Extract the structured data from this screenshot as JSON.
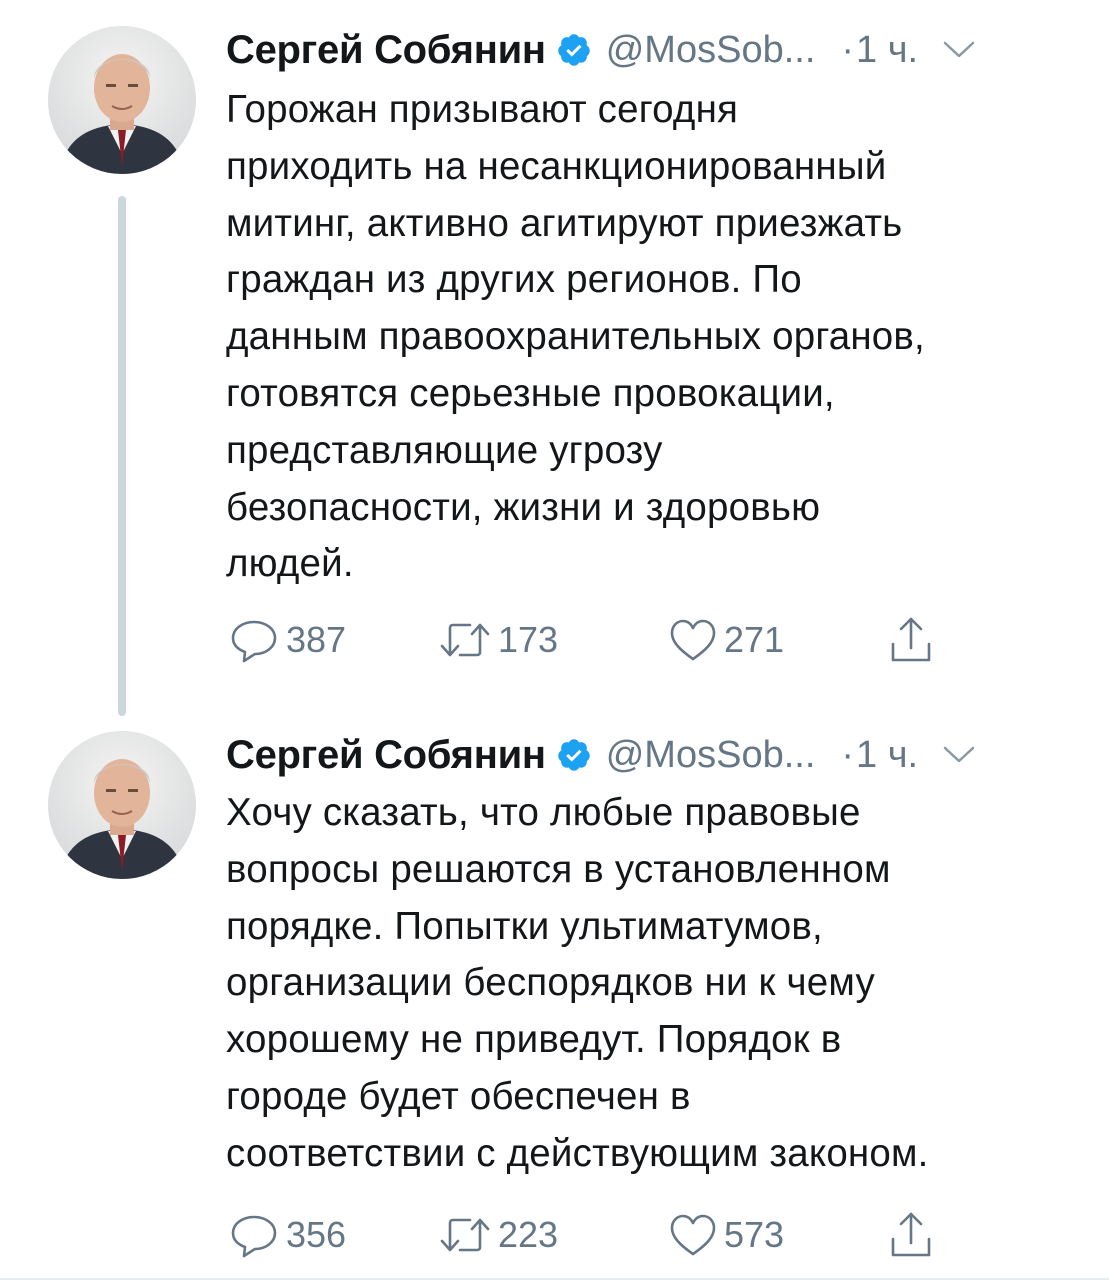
{
  "colors": {
    "text": "#14171a",
    "secondary": "#657786",
    "verified": "#1da1f2",
    "thread_line": "#ccd6dd"
  },
  "tweets": [
    {
      "author_name": "Сергей Собянин",
      "handle": "@MosSob...",
      "dot": "·",
      "time": "1 ч.",
      "verified_icon": "verified-badge-icon",
      "text": "Горожан призывают сегодня\nприходить на несанкционированный\nмитинг, активно агитируют приезжать\nграждан из других регионов. По\nданным правоохранительных органов,\nготовятся серьезные провокации,\nпредставляющие угрозу\nбезопасности, жизни и здоровью\nлюдей.",
      "replies": "387",
      "retweets": "173",
      "likes": "271"
    },
    {
      "author_name": "Сергей Собянин",
      "handle": "@MosSob...",
      "dot": "·",
      "time": "1 ч.",
      "verified_icon": "verified-badge-icon",
      "text": "Хочу сказать, что любые правовые\nвопросы решаются в установленном\nпорядке. Попытки ультиматумов,\nорганизации беспорядков ни к чему\nхорошему не приведут. Порядок в\nгороде будет обеспечен в\nсоответствии с действующим законом.",
      "replies": "356",
      "retweets": "223",
      "likes": "573"
    }
  ]
}
